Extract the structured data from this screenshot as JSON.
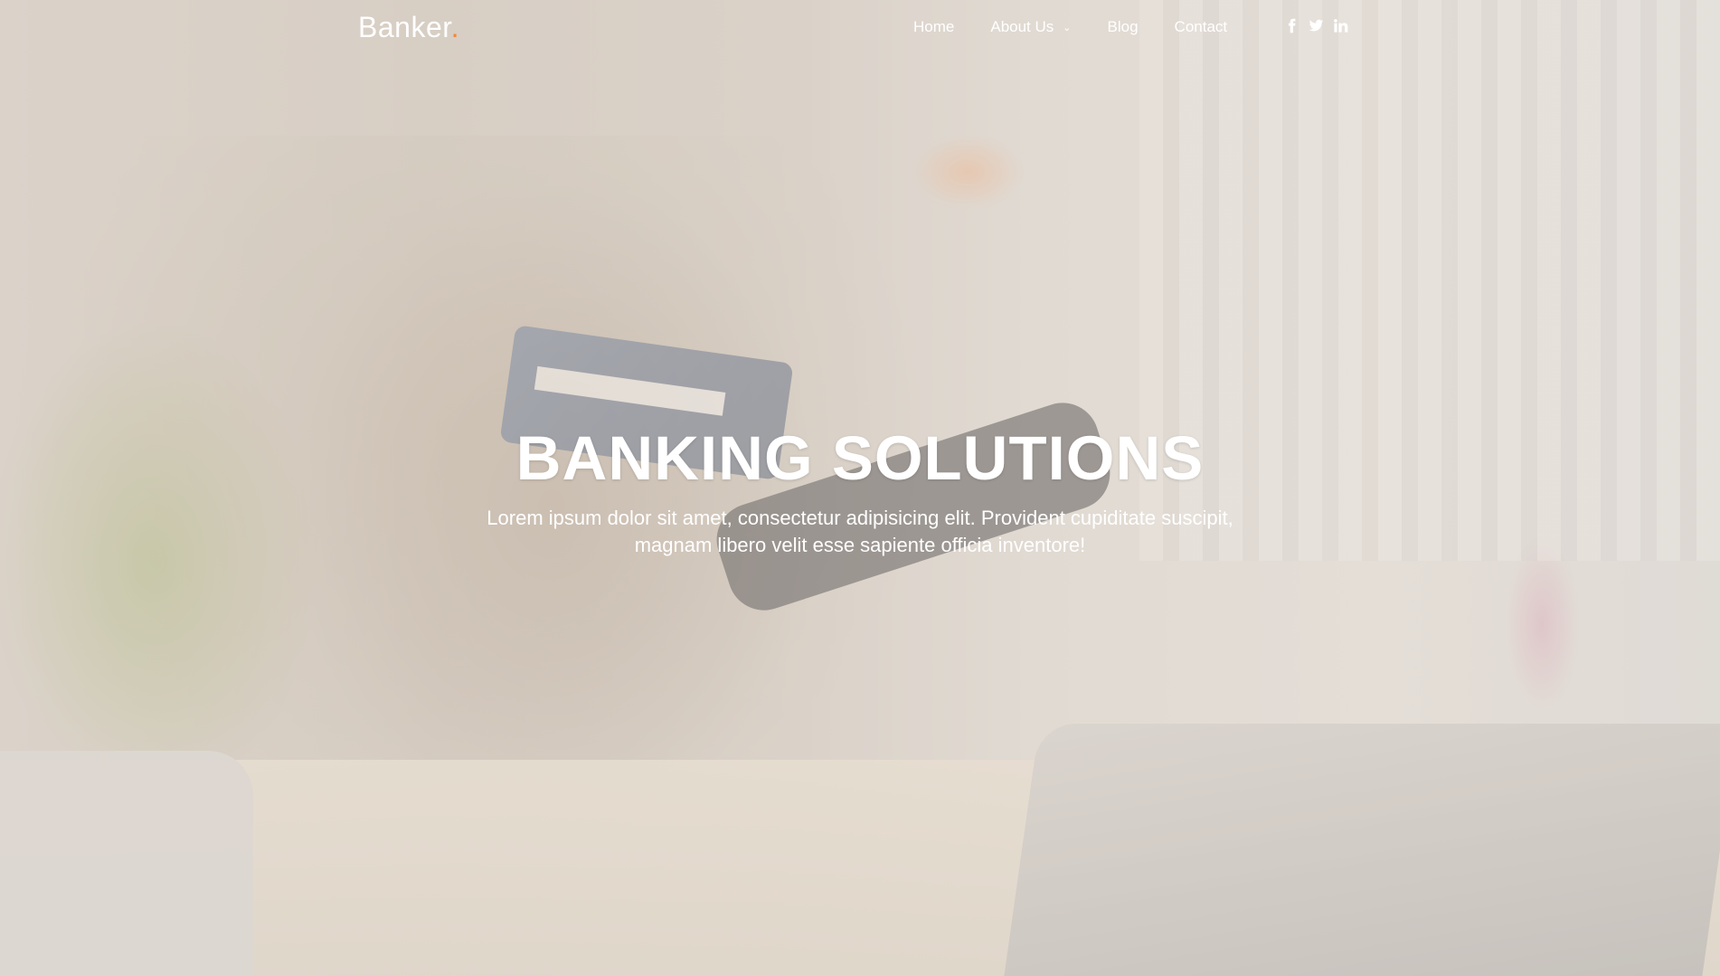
{
  "brand": {
    "name": "Banker",
    "dot": ".",
    "dot_color": "#f0883b"
  },
  "nav": {
    "items": [
      {
        "label": "Home"
      },
      {
        "label": "About Us",
        "has_dropdown": true
      },
      {
        "label": "Blog"
      },
      {
        "label": "Contact"
      }
    ]
  },
  "social": {
    "icons": [
      "facebook-icon",
      "twitter-icon",
      "linkedin-icon"
    ]
  },
  "hero": {
    "title": "BANKING SOLUTIONS",
    "subtitle": "Lorem ipsum dolor sit amet, consectetur adipisicing elit. Provident cupiditate suscipit, magnam libero velit esse sapiente officia inventore!"
  },
  "colors": {
    "text": "#ffffff",
    "accent": "#f0883b"
  }
}
